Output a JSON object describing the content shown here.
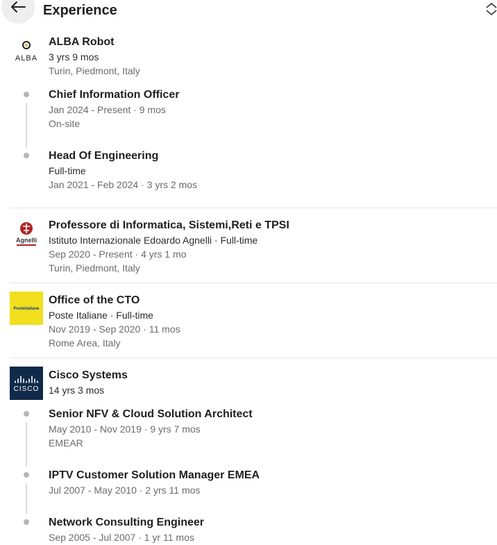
{
  "header": {
    "title": "Experience"
  },
  "icons": {
    "back": "arrow-left-icon",
    "sort": "chevron-up-down-icon"
  },
  "experiences": [
    {
      "company": "ALBA Robot",
      "duration": "3 yrs 9 mos",
      "location": "Turin, Piedmont, Italy",
      "logo_text": "ALBA",
      "roles": [
        {
          "title": "Chief Information Officer",
          "dates": "Jan 2024 - Present · 9 mos",
          "detail": "On-site"
        },
        {
          "title": "Head Of Engineering",
          "type": "Full-time",
          "dates": "Jan 2021 - Feb 2024 · 3 yrs 2 mos"
        }
      ]
    },
    {
      "title": "Professore di Informatica, Sistemi,Reti e TPSI",
      "org": "Istituto Internazionale Edoardo Agnelli · Full-time",
      "dates": "Sep 2020 - Present · 4 yrs 1 mo",
      "location": "Turin, Piedmont, Italy",
      "logo_text": "Agnelli"
    },
    {
      "title": "Office of the CTO",
      "org": "Poste Italiane · Full-time",
      "dates": "Nov 2019 - Sep 2020 · 11 mos",
      "location": "Rome Area, Italy",
      "logo_text": "Posteitaliane",
      "logo_color": "#f2df1d"
    },
    {
      "company": "Cisco Systems",
      "duration": "14 yrs 3 mos",
      "logo_text": "CISCO",
      "logo_color": "#0f2a4a",
      "roles": [
        {
          "title": "Senior NFV & Cloud Solution Architect",
          "dates": "May 2010 - Nov 2019 · 9 yrs 7 mos",
          "detail": "EMEAR"
        },
        {
          "title": "IPTV Customer Solution Manager EMEA",
          "dates": "Jul 2007 - May 2010 · 2 yrs 11 mos"
        },
        {
          "title": "Network Consulting Engineer",
          "dates": "Sep 2005 - Jul 2007 · 1 yr 11 mos"
        }
      ]
    }
  ]
}
